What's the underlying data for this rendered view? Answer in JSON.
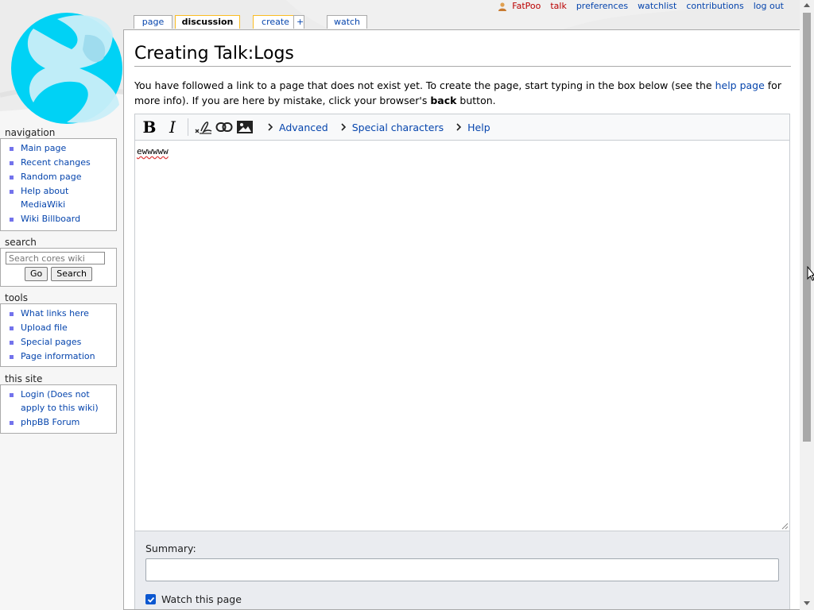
{
  "personal_tools": {
    "username": "FatPoo",
    "talk": "talk",
    "preferences": "preferences",
    "watchlist": "watchlist",
    "contributions": "contributions",
    "logout": "log out"
  },
  "tabs": {
    "page": "page",
    "discussion": "discussion",
    "create": "create",
    "plus": "+",
    "watch": "watch"
  },
  "content": {
    "title": "Creating Talk:Logs",
    "intro_1": "You have followed a link to a page that does not exist yet. To create the page, start typing in the box below (see the ",
    "intro_link": "help page",
    "intro_2": " for more info). If you are here by mistake, click your browser's ",
    "intro_bold": "back",
    "intro_3": " button."
  },
  "editor": {
    "bold": "B",
    "italic": "I",
    "advanced": "Advanced",
    "special_characters": "Special characters",
    "help": "Help",
    "text": "ewwwww"
  },
  "options": {
    "summary_label": "Summary:",
    "summary_value": "",
    "watch_label": "Watch this page",
    "watch_checked": true
  },
  "sidebar": {
    "navigation": {
      "title": "navigation",
      "items": [
        "Main page",
        "Recent changes",
        "Random page",
        "Help about MediaWiki",
        "Wiki Billboard"
      ]
    },
    "search": {
      "title": "search",
      "placeholder": "Search cores wiki",
      "go": "Go",
      "search": "Search"
    },
    "tools": {
      "title": "tools",
      "items": [
        "What links here",
        "Upload file",
        "Special pages",
        "Page information"
      ]
    },
    "this_site": {
      "title": "this site",
      "items": [
        "Login (Does not apply to this wiki)",
        "phpBB Forum"
      ]
    }
  }
}
